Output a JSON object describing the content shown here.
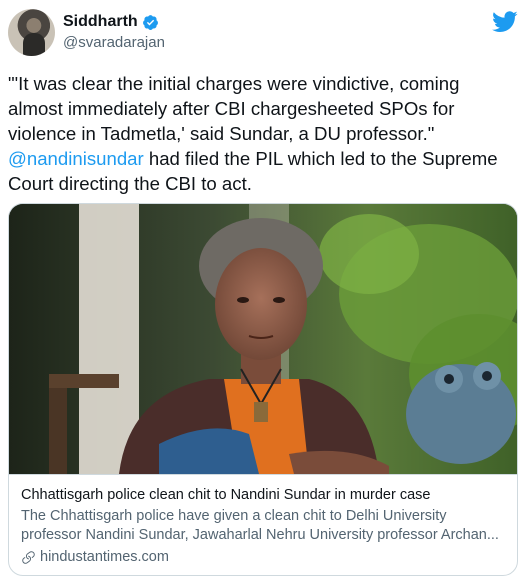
{
  "author": {
    "name": "Siddharth",
    "handle": "@svaradarajan",
    "verified": true
  },
  "tweet": {
    "text_before": "\"'It was clear the initial charges were vindictive, coming almost immediately after CBI chargesheeted SPOs for violence in Tadmetla,' said Sundar, a DU professor.\"",
    "mention": "@nandinisundar",
    "text_after": " had filed the PIL which led to the Supreme Court directing the CBI to act."
  },
  "card": {
    "title": "Chhattisgarh police clean chit to Nandini Sundar in murder case",
    "description_line1": "The Chhattisgarh police have given a clean chit to Delhi University",
    "description_line2": "professor Nandini Sundar, Jawaharlal Nehru University professor Archan...",
    "domain": "hindustantimes.com"
  },
  "colors": {
    "accent": "#1d9bf0",
    "text": "#0f1419",
    "secondary": "#536471",
    "border": "#cfd9de"
  },
  "icons": {
    "verified": "verified-badge-icon",
    "brand": "twitter-bird-icon",
    "link": "link-icon"
  }
}
